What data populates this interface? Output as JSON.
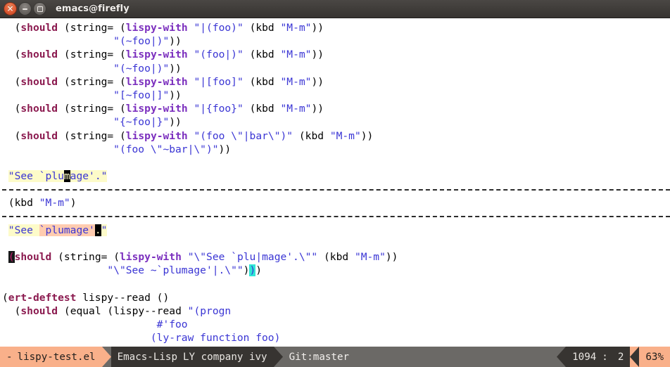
{
  "window": {
    "title": "emacs@firefly",
    "controls": [
      {
        "name": "close",
        "glyph": "×"
      },
      {
        "name": "minimize",
        "glyph": ""
      },
      {
        "name": "maximize",
        "glyph": ""
      }
    ]
  },
  "colors": {
    "titlebar_bg": "#3e3b38",
    "buffer_bg": "#ffffff",
    "keyword": "#8b1a4f",
    "function": "#7b2fbe",
    "string": "#3a35d4",
    "highlight_yellow": "#fdfbc9",
    "highlight_salmon": "#ffccb0",
    "paren_match": "#30e6d6",
    "modeline_accent": "#f9b08a",
    "modeline_dark": "#373431",
    "modeline_gray": "#6b6966"
  },
  "buffer": {
    "lines": [
      {
        "type": "code",
        "tokens": [
          {
            "t": "  ",
            "c": "plain"
          },
          {
            "t": "(",
            "c": "paren"
          },
          {
            "t": "should",
            "c": "kw"
          },
          {
            "t": " ",
            "c": "plain"
          },
          {
            "t": "(",
            "c": "paren"
          },
          {
            "t": "string=",
            "c": "plain"
          },
          {
            "t": " ",
            "c": "plain"
          },
          {
            "t": "(",
            "c": "paren"
          },
          {
            "t": "lispy-with",
            "c": "fn"
          },
          {
            "t": " ",
            "c": "plain"
          },
          {
            "t": "\"|(foo)\"",
            "c": "str"
          },
          {
            "t": " ",
            "c": "plain"
          },
          {
            "t": "(",
            "c": "paren"
          },
          {
            "t": "kbd",
            "c": "plain"
          },
          {
            "t": " ",
            "c": "plain"
          },
          {
            "t": "\"M-m\"",
            "c": "str"
          },
          {
            "t": "))",
            "c": "paren"
          }
        ]
      },
      {
        "type": "code",
        "tokens": [
          {
            "t": "                  ",
            "c": "plain"
          },
          {
            "t": "\"(~foo|)\"",
            "c": "str"
          },
          {
            "t": "))",
            "c": "paren"
          }
        ]
      },
      {
        "type": "code",
        "tokens": [
          {
            "t": "  ",
            "c": "plain"
          },
          {
            "t": "(",
            "c": "paren"
          },
          {
            "t": "should",
            "c": "kw"
          },
          {
            "t": " ",
            "c": "plain"
          },
          {
            "t": "(",
            "c": "paren"
          },
          {
            "t": "string=",
            "c": "plain"
          },
          {
            "t": " ",
            "c": "plain"
          },
          {
            "t": "(",
            "c": "paren"
          },
          {
            "t": "lispy-with",
            "c": "fn"
          },
          {
            "t": " ",
            "c": "plain"
          },
          {
            "t": "\"(foo|)\"",
            "c": "str"
          },
          {
            "t": " ",
            "c": "plain"
          },
          {
            "t": "(",
            "c": "paren"
          },
          {
            "t": "kbd",
            "c": "plain"
          },
          {
            "t": " ",
            "c": "plain"
          },
          {
            "t": "\"M-m\"",
            "c": "str"
          },
          {
            "t": "))",
            "c": "paren"
          }
        ]
      },
      {
        "type": "code",
        "tokens": [
          {
            "t": "                  ",
            "c": "plain"
          },
          {
            "t": "\"(~foo|)\"",
            "c": "str"
          },
          {
            "t": "))",
            "c": "paren"
          }
        ]
      },
      {
        "type": "code",
        "tokens": [
          {
            "t": "  ",
            "c": "plain"
          },
          {
            "t": "(",
            "c": "paren"
          },
          {
            "t": "should",
            "c": "kw"
          },
          {
            "t": " ",
            "c": "plain"
          },
          {
            "t": "(",
            "c": "paren"
          },
          {
            "t": "string=",
            "c": "plain"
          },
          {
            "t": " ",
            "c": "plain"
          },
          {
            "t": "(",
            "c": "paren"
          },
          {
            "t": "lispy-with",
            "c": "fn"
          },
          {
            "t": " ",
            "c": "plain"
          },
          {
            "t": "\"|[foo]\"",
            "c": "str"
          },
          {
            "t": " ",
            "c": "plain"
          },
          {
            "t": "(",
            "c": "paren"
          },
          {
            "t": "kbd",
            "c": "plain"
          },
          {
            "t": " ",
            "c": "plain"
          },
          {
            "t": "\"M-m\"",
            "c": "str"
          },
          {
            "t": "))",
            "c": "paren"
          }
        ]
      },
      {
        "type": "code",
        "tokens": [
          {
            "t": "                  ",
            "c": "plain"
          },
          {
            "t": "\"[~foo|]\"",
            "c": "str"
          },
          {
            "t": "))",
            "c": "paren"
          }
        ]
      },
      {
        "type": "code",
        "tokens": [
          {
            "t": "  ",
            "c": "plain"
          },
          {
            "t": "(",
            "c": "paren"
          },
          {
            "t": "should",
            "c": "kw"
          },
          {
            "t": " ",
            "c": "plain"
          },
          {
            "t": "(",
            "c": "paren"
          },
          {
            "t": "string=",
            "c": "plain"
          },
          {
            "t": " ",
            "c": "plain"
          },
          {
            "t": "(",
            "c": "paren"
          },
          {
            "t": "lispy-with",
            "c": "fn"
          },
          {
            "t": " ",
            "c": "plain"
          },
          {
            "t": "\"|{foo}\"",
            "c": "str"
          },
          {
            "t": " ",
            "c": "plain"
          },
          {
            "t": "(",
            "c": "paren"
          },
          {
            "t": "kbd",
            "c": "plain"
          },
          {
            "t": " ",
            "c": "plain"
          },
          {
            "t": "\"M-m\"",
            "c": "str"
          },
          {
            "t": "))",
            "c": "paren"
          }
        ]
      },
      {
        "type": "code",
        "tokens": [
          {
            "t": "                  ",
            "c": "plain"
          },
          {
            "t": "\"{~foo|}\"",
            "c": "str"
          },
          {
            "t": "))",
            "c": "paren"
          }
        ]
      },
      {
        "type": "code",
        "tokens": [
          {
            "t": "  ",
            "c": "plain"
          },
          {
            "t": "(",
            "c": "paren"
          },
          {
            "t": "should",
            "c": "kw"
          },
          {
            "t": " ",
            "c": "plain"
          },
          {
            "t": "(",
            "c": "paren"
          },
          {
            "t": "string=",
            "c": "plain"
          },
          {
            "t": " ",
            "c": "plain"
          },
          {
            "t": "(",
            "c": "paren"
          },
          {
            "t": "lispy-with",
            "c": "fn"
          },
          {
            "t": " ",
            "c": "plain"
          },
          {
            "t": "\"(foo \\\"|bar\\\")\"",
            "c": "str"
          },
          {
            "t": " ",
            "c": "plain"
          },
          {
            "t": "(",
            "c": "paren"
          },
          {
            "t": "kbd",
            "c": "plain"
          },
          {
            "t": " ",
            "c": "plain"
          },
          {
            "t": "\"M-m\"",
            "c": "str"
          },
          {
            "t": "))",
            "c": "paren"
          }
        ]
      },
      {
        "type": "code",
        "tokens": [
          {
            "t": "                  ",
            "c": "plain"
          },
          {
            "t": "\"(foo \\\"~bar|\\\")\"",
            "c": "str"
          },
          {
            "t": "))",
            "c": "paren"
          }
        ]
      },
      {
        "type": "blank",
        "tokens": []
      },
      {
        "type": "code",
        "tokens": [
          {
            "t": " ",
            "c": "plain"
          },
          {
            "t": "\"See `plu",
            "c": "str hl-yellow"
          },
          {
            "t": "m",
            "c": "cursor-blk"
          },
          {
            "t": "age'.\"",
            "c": "str hl-yellow"
          }
        ]
      },
      {
        "type": "separator",
        "tokens": []
      },
      {
        "type": "code",
        "tokens": [
          {
            "t": " ",
            "c": "plain"
          },
          {
            "t": "(",
            "c": "paren"
          },
          {
            "t": "kbd",
            "c": "plain"
          },
          {
            "t": " ",
            "c": "plain"
          },
          {
            "t": "\"M-m\"",
            "c": "str"
          },
          {
            "t": ")",
            "c": "paren"
          }
        ]
      },
      {
        "type": "separator",
        "tokens": []
      },
      {
        "type": "code",
        "tokens": [
          {
            "t": " ",
            "c": "plain"
          },
          {
            "t": "\"See ",
            "c": "str hl-yellow"
          },
          {
            "t": "`plumage'",
            "c": "str hl-salmon"
          },
          {
            "t": ".",
            "c": "cursor-blk"
          },
          {
            "t": "\"",
            "c": "str hl-yellow"
          }
        ]
      },
      {
        "type": "blank",
        "tokens": []
      },
      {
        "type": "code",
        "tokens": [
          {
            "t": " ",
            "c": "plain"
          },
          {
            "t": "(",
            "c": "cursor-open"
          },
          {
            "t": "should",
            "c": "kw"
          },
          {
            "t": " ",
            "c": "plain"
          },
          {
            "t": "(",
            "c": "paren"
          },
          {
            "t": "string=",
            "c": "plain"
          },
          {
            "t": " ",
            "c": "plain"
          },
          {
            "t": "(",
            "c": "paren"
          },
          {
            "t": "lispy-with",
            "c": "fn"
          },
          {
            "t": " ",
            "c": "plain"
          },
          {
            "t": "\"\\\"See `plu|mage'.\\\"\"",
            "c": "str"
          },
          {
            "t": " ",
            "c": "plain"
          },
          {
            "t": "(",
            "c": "paren"
          },
          {
            "t": "kbd",
            "c": "plain"
          },
          {
            "t": " ",
            "c": "plain"
          },
          {
            "t": "\"M-m\"",
            "c": "str"
          },
          {
            "t": "))",
            "c": "paren"
          }
        ]
      },
      {
        "type": "code",
        "tokens": [
          {
            "t": "                 ",
            "c": "plain"
          },
          {
            "t": "\"\\\"See ~`plumage'|.\\\"\"",
            "c": "str"
          },
          {
            "t": ")",
            "c": "paren"
          },
          {
            "t": ")",
            "c": "paren-match"
          },
          {
            "t": ")",
            "c": "paren"
          }
        ]
      },
      {
        "type": "blank",
        "tokens": []
      },
      {
        "type": "code",
        "tokens": [
          {
            "t": "(",
            "c": "paren"
          },
          {
            "t": "ert-deftest",
            "c": "kw"
          },
          {
            "t": " lispy--read ()",
            "c": "plain"
          }
        ]
      },
      {
        "type": "code",
        "tokens": [
          {
            "t": "  ",
            "c": "plain"
          },
          {
            "t": "(",
            "c": "paren"
          },
          {
            "t": "should",
            "c": "kw"
          },
          {
            "t": " ",
            "c": "plain"
          },
          {
            "t": "(",
            "c": "paren"
          },
          {
            "t": "equal",
            "c": "plain"
          },
          {
            "t": " ",
            "c": "plain"
          },
          {
            "t": "(",
            "c": "paren"
          },
          {
            "t": "lispy--read",
            "c": "plain"
          },
          {
            "t": " ",
            "c": "plain"
          },
          {
            "t": "\"(progn",
            "c": "str"
          }
        ]
      },
      {
        "type": "code",
        "tokens": [
          {
            "t": "                         ",
            "c": "plain"
          },
          {
            "t": "#'foo",
            "c": "str"
          }
        ]
      },
      {
        "type": "code",
        "tokens": [
          {
            "t": "                        ",
            "c": "plain"
          },
          {
            "t": "(ly-raw function foo)",
            "c": "str"
          }
        ]
      }
    ]
  },
  "modeline": {
    "buffer_state": "-",
    "buffer_name": "lispy-test.el",
    "major_mode": "Emacs-Lisp",
    "minor_modes": "LY company ivy",
    "vcs": "Git:master",
    "line_number": "1094",
    "column_separator": ":",
    "column_number": "2",
    "scroll_percent": "63%"
  }
}
